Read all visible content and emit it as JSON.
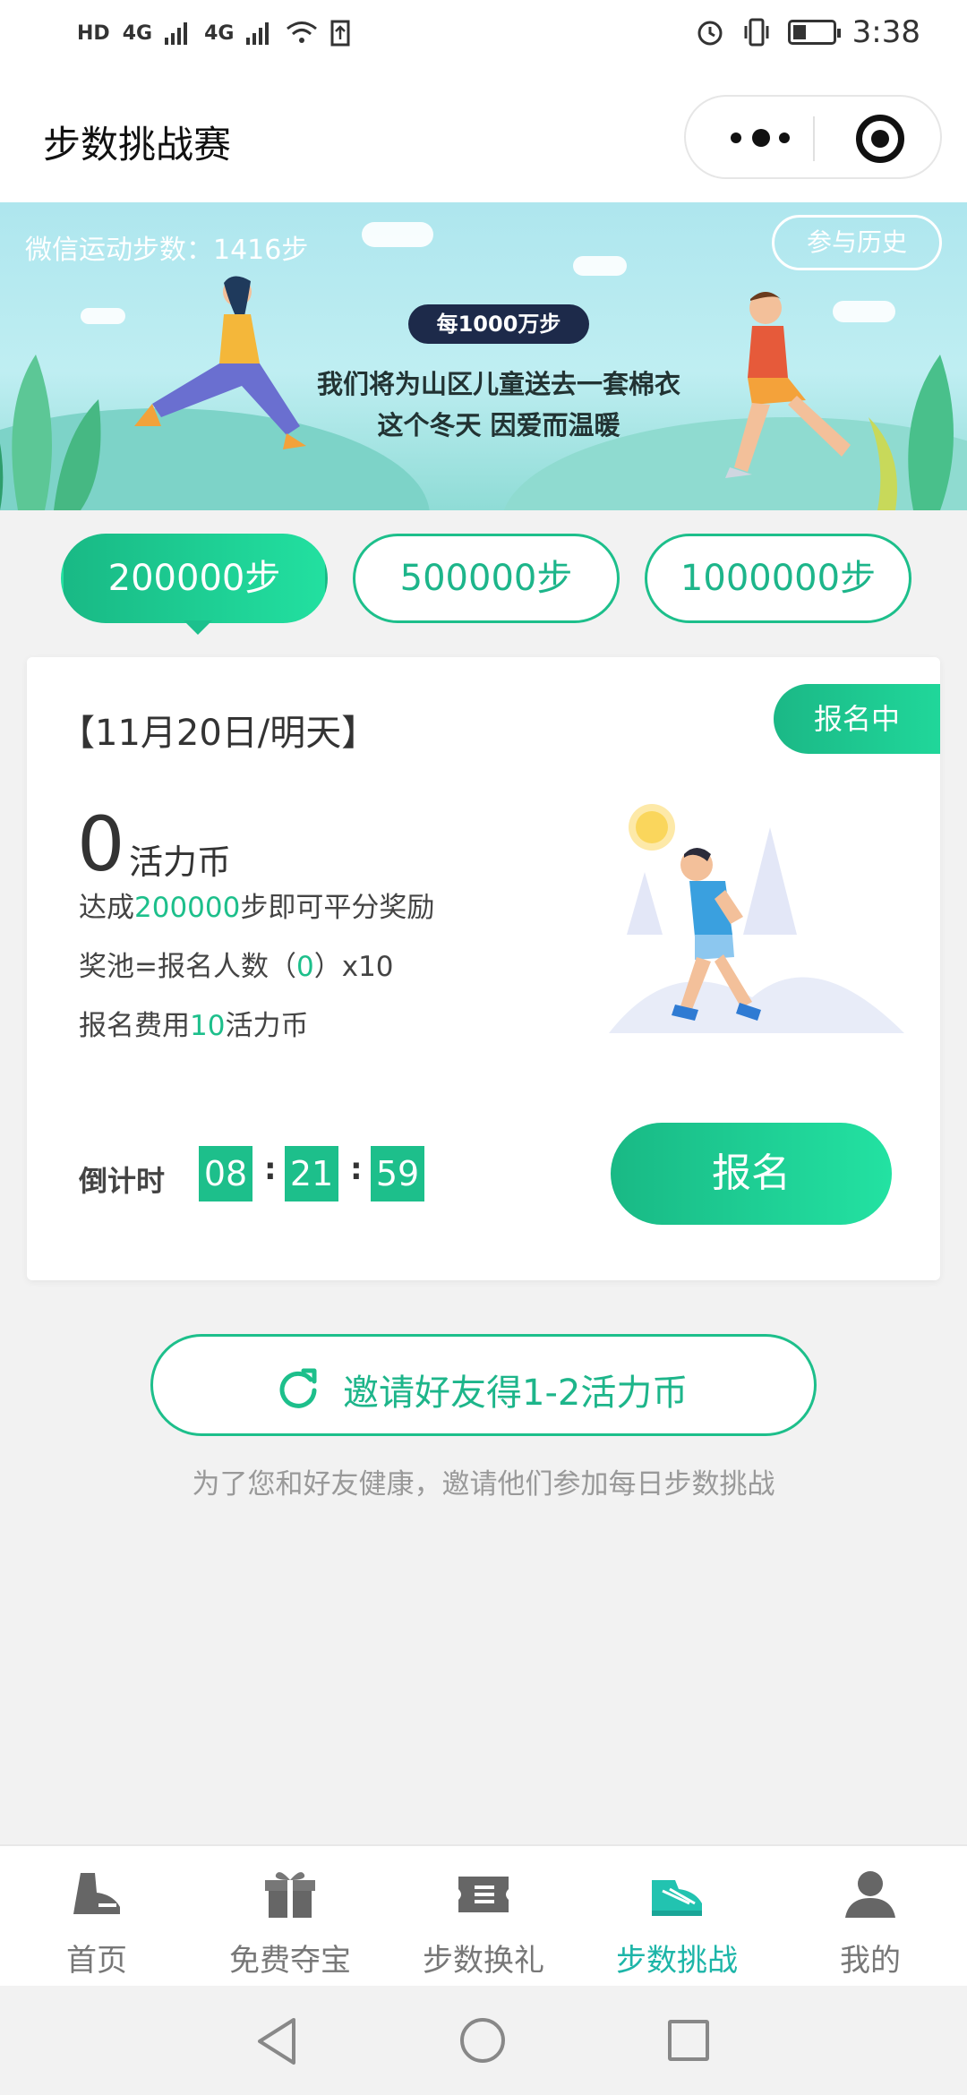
{
  "status_bar": {
    "network_left": [
      "HD",
      "4G",
      "4G"
    ],
    "time": "3:38"
  },
  "header": {
    "title": "步数挑战赛"
  },
  "banner": {
    "wechat_steps": "微信运动步数：1416步",
    "history_label": "参与历史",
    "tag": "每1000万步",
    "slogan_line1": "我们将为山区儿童送去一套棉衣",
    "slogan_line2": "这个冬天  因爱而温暖"
  },
  "tabs": [
    {
      "label": "200000步",
      "active": true
    },
    {
      "label": "500000步",
      "active": false
    },
    {
      "label": "1000000步",
      "active": false
    }
  ],
  "card": {
    "date": "【11月20日/明天】",
    "status": "报名中",
    "coins": "0",
    "coin_unit": "活力币",
    "rule1_prefix": "达成",
    "rule1_value": "200000",
    "rule1_suffix": "步即可平分奖励",
    "rule2_prefix": "奖池=报名人数（",
    "rule2_value": "0",
    "rule2_suffix": "）x10",
    "rule3_prefix": "报名费用",
    "rule3_value": "10",
    "rule3_suffix": "活力币",
    "countdown_label": "倒计时",
    "countdown": [
      "08",
      "21",
      "59"
    ],
    "signup_label": "报名"
  },
  "invite": {
    "button_label": "邀请好友得1-2活力币",
    "subtitle": "为了您和好友健康，邀请他们参加每日步数挑战"
  },
  "tabbar": [
    {
      "label": "首页",
      "icon": "shoe-icon",
      "active": false
    },
    {
      "label": "免费夺宝",
      "icon": "gift-icon",
      "active": false
    },
    {
      "label": "步数换礼",
      "icon": "ticket-icon",
      "active": false
    },
    {
      "label": "步数挑战",
      "icon": "sneaker-icon",
      "active": true
    },
    {
      "label": "我的",
      "icon": "user-icon",
      "active": false
    }
  ],
  "colors": {
    "accent": "#1dbf8b",
    "accent_light": "#23e2a2",
    "tab_active_text": "#1db5a8",
    "banner_tag_bg": "#1d2a4a"
  }
}
